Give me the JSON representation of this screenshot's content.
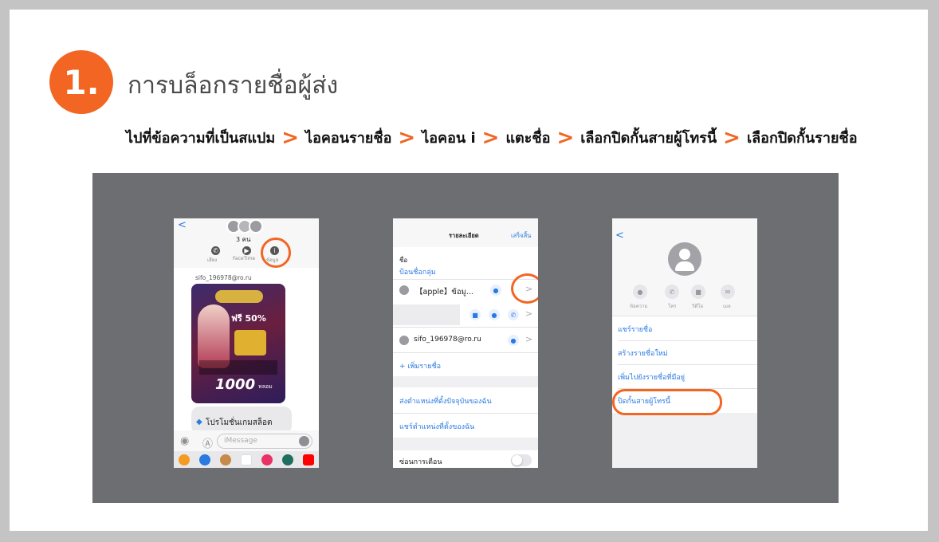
{
  "step": {
    "number": "1.",
    "title": "การบล็อกรายชื่อผู้ส่ง"
  },
  "steps": [
    "ไปที่ข้อความที่เป็นสแปม",
    "ไอคอนรายชื่อ",
    "ไอคอน i",
    "แตะชื่อ",
    "เลือกปิดกั้นสายผู้โทรนี้",
    "เลือกปิดกั้นรายชื่อ"
  ],
  "phone1": {
    "back": "<",
    "group_count": "3 คน",
    "actions": [
      "เสียง",
      "FaceTime",
      "ข้อมูล"
    ],
    "sender": "sifo_196978@ro.ru",
    "promo_badge": "ฟรี 50%",
    "promo_amount": "1000",
    "promo_unit": "หลอม",
    "bubble_text": "โปรโมชั่นเกมสล็อต",
    "input_placeholder": "iMessage"
  },
  "phone2": {
    "header_title": "รายละเอียด",
    "header_done": "เสร็จสิ้น",
    "name_label": "ชื่อ",
    "name_hint": "ป้อนชื่อกลุ่ม",
    "contact1": "【apple】ข้อมู...",
    "contact2": "sifo_196978@ro.ru",
    "add_contact": "+ เพิ่มรายชื่อ",
    "send_location": "ส่งตำแหน่งที่ตั้งปัจจุบันของฉัน",
    "share_location": "แชร์ตำแหน่งที่ตั้งของฉัน",
    "hide_alerts": "ซ่อนการเตือน"
  },
  "phone3": {
    "back": "<",
    "actions": [
      "ข้อความ",
      "โทร",
      "วิดีโอ",
      "เมล"
    ],
    "share_contact": "แชร์รายชื่อ",
    "new_contact": "สร้างรายชื่อใหม่",
    "add_existing": "เพิ่มไปยังรายชื่อที่มีอยู่",
    "block_caller": "ปิดกั้นสายผู้โทรนี้"
  },
  "colors": {
    "accent": "#f26522",
    "panel": "#6d6e71",
    "ios_blue": "#2a7ae2"
  }
}
